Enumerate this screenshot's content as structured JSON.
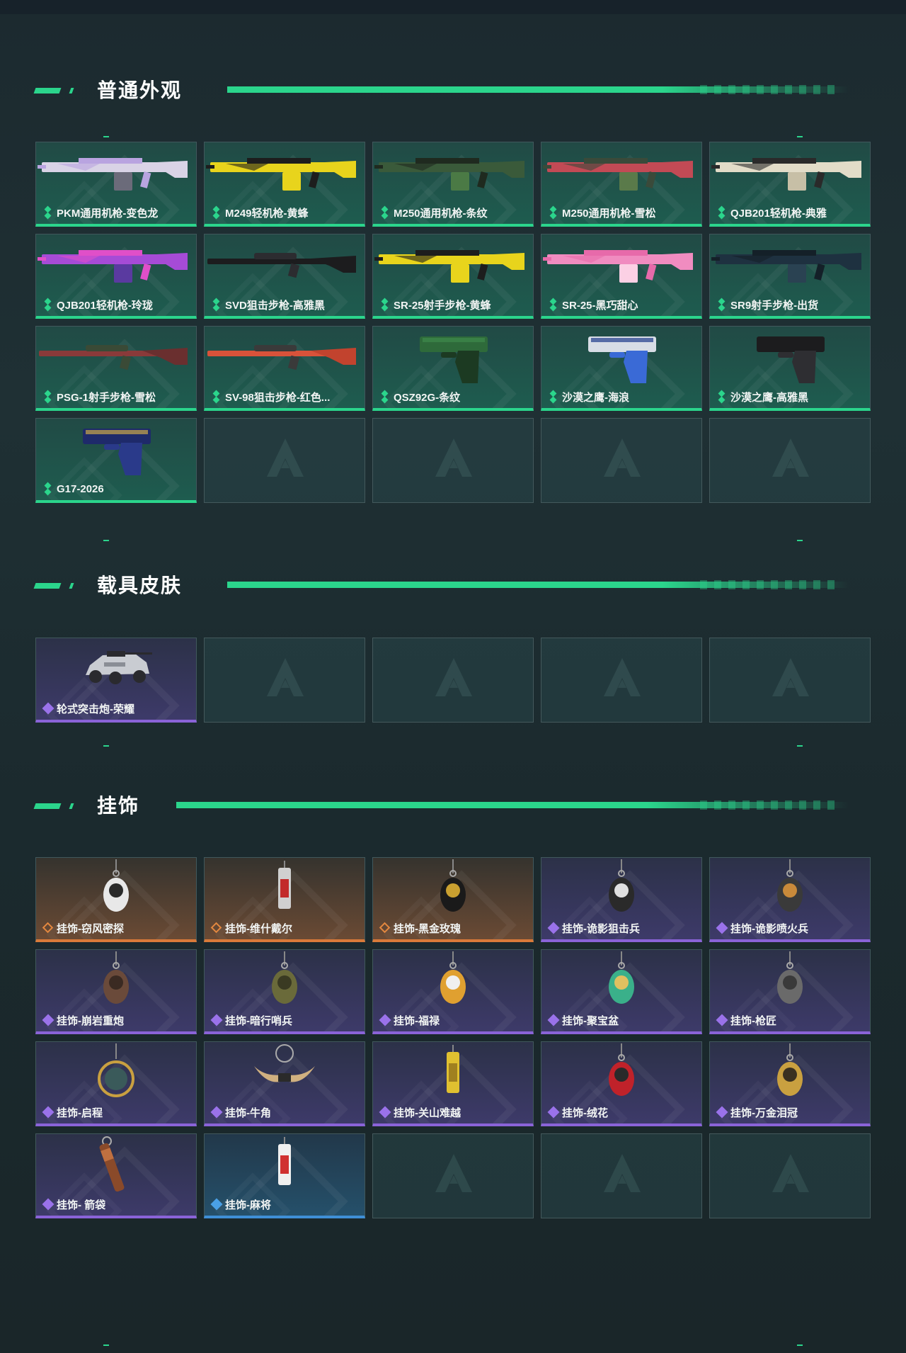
{
  "sections": {
    "weapons": {
      "title": "普通外观",
      "items": [
        {
          "name": "PKM通用机枪-变色龙",
          "rarity": "green",
          "art": "rifle",
          "colors": [
            "#d9d3e6",
            "#b9a4e0",
            "#6b6b7a"
          ]
        },
        {
          "name": "M249轻机枪-黄蜂",
          "rarity": "green",
          "art": "rifle",
          "colors": [
            "#e8d41c",
            "#1d1d1d",
            "#e8d41c"
          ]
        },
        {
          "name": "M250通用机枪-条纹",
          "rarity": "green",
          "art": "rifle",
          "colors": [
            "#3a5a3a",
            "#1f2a1f",
            "#4b7a45"
          ]
        },
        {
          "name": "M250通用机枪-雪松",
          "rarity": "green",
          "art": "rifle",
          "colors": [
            "#c24a55",
            "#3a4a3a",
            "#5a7a4a"
          ]
        },
        {
          "name": "QJB201轻机枪-典雅",
          "rarity": "green",
          "art": "rifle",
          "colors": [
            "#e2dcc8",
            "#2a2a2a",
            "#c7bfa6"
          ]
        },
        {
          "name": "QJB201轻机枪-玲珑",
          "rarity": "green",
          "art": "rifle",
          "colors": [
            "#a64bd6",
            "#e04fc8",
            "#5a3aa0"
          ]
        },
        {
          "name": "SVD狙击步枪-高雅黑",
          "rarity": "green",
          "art": "sniper",
          "colors": [
            "#1c1c1e",
            "#2c2c30",
            "#1c1c1e"
          ]
        },
        {
          "name": "SR-25射手步枪-黄蜂",
          "rarity": "green",
          "art": "rifle",
          "colors": [
            "#e8d41c",
            "#1d1d1d",
            "#e8d41c"
          ]
        },
        {
          "name": "SR-25-黑巧甜心",
          "rarity": "green",
          "art": "rifle",
          "colors": [
            "#f08cc0",
            "#e76aaa",
            "#fbd0e4"
          ]
        },
        {
          "name": "SR9射手步枪-出货",
          "rarity": "green",
          "art": "rifle",
          "colors": [
            "#1e3140",
            "#142028",
            "#2a4252"
          ]
        },
        {
          "name": "PSG-1射手步枪-雪松",
          "rarity": "green",
          "art": "sniper",
          "colors": [
            "#8a3a3a",
            "#3a4a36",
            "#6a2f2f"
          ]
        },
        {
          "name": "SV-98狙击步枪-红色...",
          "rarity": "green",
          "art": "sniper",
          "colors": [
            "#d9523a",
            "#3a3a3a",
            "#c2432e"
          ]
        },
        {
          "name": "QSZ92G-条纹",
          "rarity": "green",
          "art": "pistol",
          "colors": [
            "#2e6a3a",
            "#1c3a22",
            "#3f8a4c"
          ]
        },
        {
          "name": "沙漠之鹰-海浪",
          "rarity": "green",
          "art": "pistol",
          "colors": [
            "#d8dde6",
            "#3a6ad6",
            "#1f3b8a"
          ]
        },
        {
          "name": "沙漠之鹰-高雅黑",
          "rarity": "green",
          "art": "pistol",
          "colors": [
            "#1c1c1e",
            "#2e2e32",
            "#1c1c1e"
          ]
        },
        {
          "name": "G17-2026",
          "rarity": "green",
          "art": "pistol",
          "colors": [
            "#1e2a6a",
            "#2a3a8a",
            "#c9a84a"
          ]
        },
        {
          "empty": true
        },
        {
          "empty": true
        },
        {
          "empty": true
        },
        {
          "empty": true
        }
      ]
    },
    "vehicles": {
      "title": "载具皮肤",
      "items": [
        {
          "name": "轮式突击炮-荣耀",
          "rarity": "purple",
          "art": "vehicle",
          "colors": [
            "#c9ccd2",
            "#2a2a2e",
            "#8a8e96"
          ]
        },
        {
          "empty": true
        },
        {
          "empty": true
        },
        {
          "empty": true
        },
        {
          "empty": true
        }
      ]
    },
    "charms": {
      "title": "挂饰",
      "items": [
        {
          "name": "挂饰-窃风密探",
          "rarity": "orange",
          "art": "charm",
          "colors": [
            "#e8e8e8",
            "#2a2a2a"
          ]
        },
        {
          "name": "挂饰-维什戴尔",
          "rarity": "orange",
          "art": "charm-tall",
          "colors": [
            "#d0d0d0",
            "#c22a2a"
          ]
        },
        {
          "name": "挂饰-黑金玫瑰",
          "rarity": "orange",
          "art": "charm",
          "colors": [
            "#1a1a1a",
            "#c9a030"
          ]
        },
        {
          "name": "挂饰-诡影狙击兵",
          "rarity": "purple",
          "art": "charm",
          "colors": [
            "#2a2a2a",
            "#e0e0e0"
          ]
        },
        {
          "name": "挂饰-诡影喷火兵",
          "rarity": "purple",
          "art": "charm",
          "colors": [
            "#3a3a3a",
            "#c98a3a"
          ]
        },
        {
          "name": "挂饰-崩岩重炮",
          "rarity": "purple",
          "art": "charm",
          "colors": [
            "#6a4a3a",
            "#3a2a22"
          ]
        },
        {
          "name": "挂饰-暗行哨兵",
          "rarity": "purple",
          "art": "charm",
          "colors": [
            "#6a6a3a",
            "#3a3a22"
          ]
        },
        {
          "name": "挂饰-福禄",
          "rarity": "purple",
          "art": "charm",
          "colors": [
            "#e0a030",
            "#f0f0f0"
          ]
        },
        {
          "name": "挂饰-聚宝盆",
          "rarity": "purple",
          "art": "charm",
          "colors": [
            "#3ab08a",
            "#e0c060"
          ]
        },
        {
          "name": "挂饰-枪匠",
          "rarity": "purple",
          "art": "charm",
          "colors": [
            "#6a6a6a",
            "#3a3a3a"
          ]
        },
        {
          "name": "挂饰-启程",
          "rarity": "purple",
          "art": "charm-ring",
          "colors": [
            "#3a5a5a",
            "#c9a040"
          ]
        },
        {
          "name": "挂饰-牛角",
          "rarity": "purple",
          "art": "charm-horn",
          "colors": [
            "#d0b080",
            "#2a2a2a"
          ]
        },
        {
          "name": "挂饰-关山难越",
          "rarity": "purple",
          "art": "charm-tall",
          "colors": [
            "#e0c030",
            "#a08020"
          ]
        },
        {
          "name": "挂饰-绒花",
          "rarity": "purple",
          "art": "charm",
          "colors": [
            "#c0222a",
            "#2a2a2a"
          ]
        },
        {
          "name": "挂饰-万金泪冠",
          "rarity": "purple",
          "art": "charm",
          "colors": [
            "#c9a040",
            "#3a3020"
          ]
        },
        {
          "name": "挂饰- 箭袋",
          "rarity": "purple",
          "art": "charm-stick",
          "colors": [
            "#8a4a2a",
            "#c07040"
          ]
        },
        {
          "name": "挂饰-麻将",
          "rarity": "blue",
          "art": "charm-tall",
          "colors": [
            "#f0f0f0",
            "#d03030"
          ]
        },
        {
          "empty": true
        },
        {
          "empty": true
        },
        {
          "empty": true
        }
      ]
    }
  }
}
